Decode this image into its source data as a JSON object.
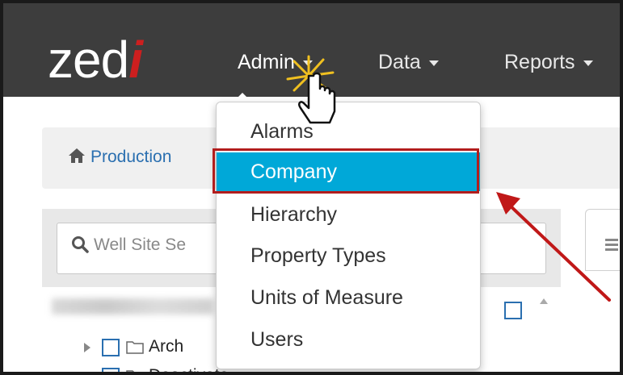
{
  "app": {
    "logo_main": "zed",
    "logo_accent": "i"
  },
  "nav": {
    "items": [
      {
        "label": "Admin"
      },
      {
        "label": "Data"
      },
      {
        "label": "Reports"
      }
    ]
  },
  "breadcrumb": {
    "text": "Production"
  },
  "search": {
    "placeholder": "Well Site Se"
  },
  "tree": {
    "rows": [
      {
        "label": "Arch"
      },
      {
        "label": "Deactivate"
      }
    ]
  },
  "dropdown": {
    "items": [
      {
        "label": "Alarms"
      },
      {
        "label": "Company"
      },
      {
        "label": "Hierarchy"
      },
      {
        "label": "Property Types"
      },
      {
        "label": "Units of Measure"
      },
      {
        "label": "Users"
      }
    ],
    "active": "Company"
  },
  "colors": {
    "navbar": "#3d3d3d",
    "accent": "#00a8d8",
    "highlight": "#b21d1d",
    "logo_accent": "#cc1f1f"
  },
  "icons": [
    "home-icon",
    "search-icon",
    "folder-icon",
    "pointer-hand-icon",
    "annotation-arrow-icon"
  ]
}
